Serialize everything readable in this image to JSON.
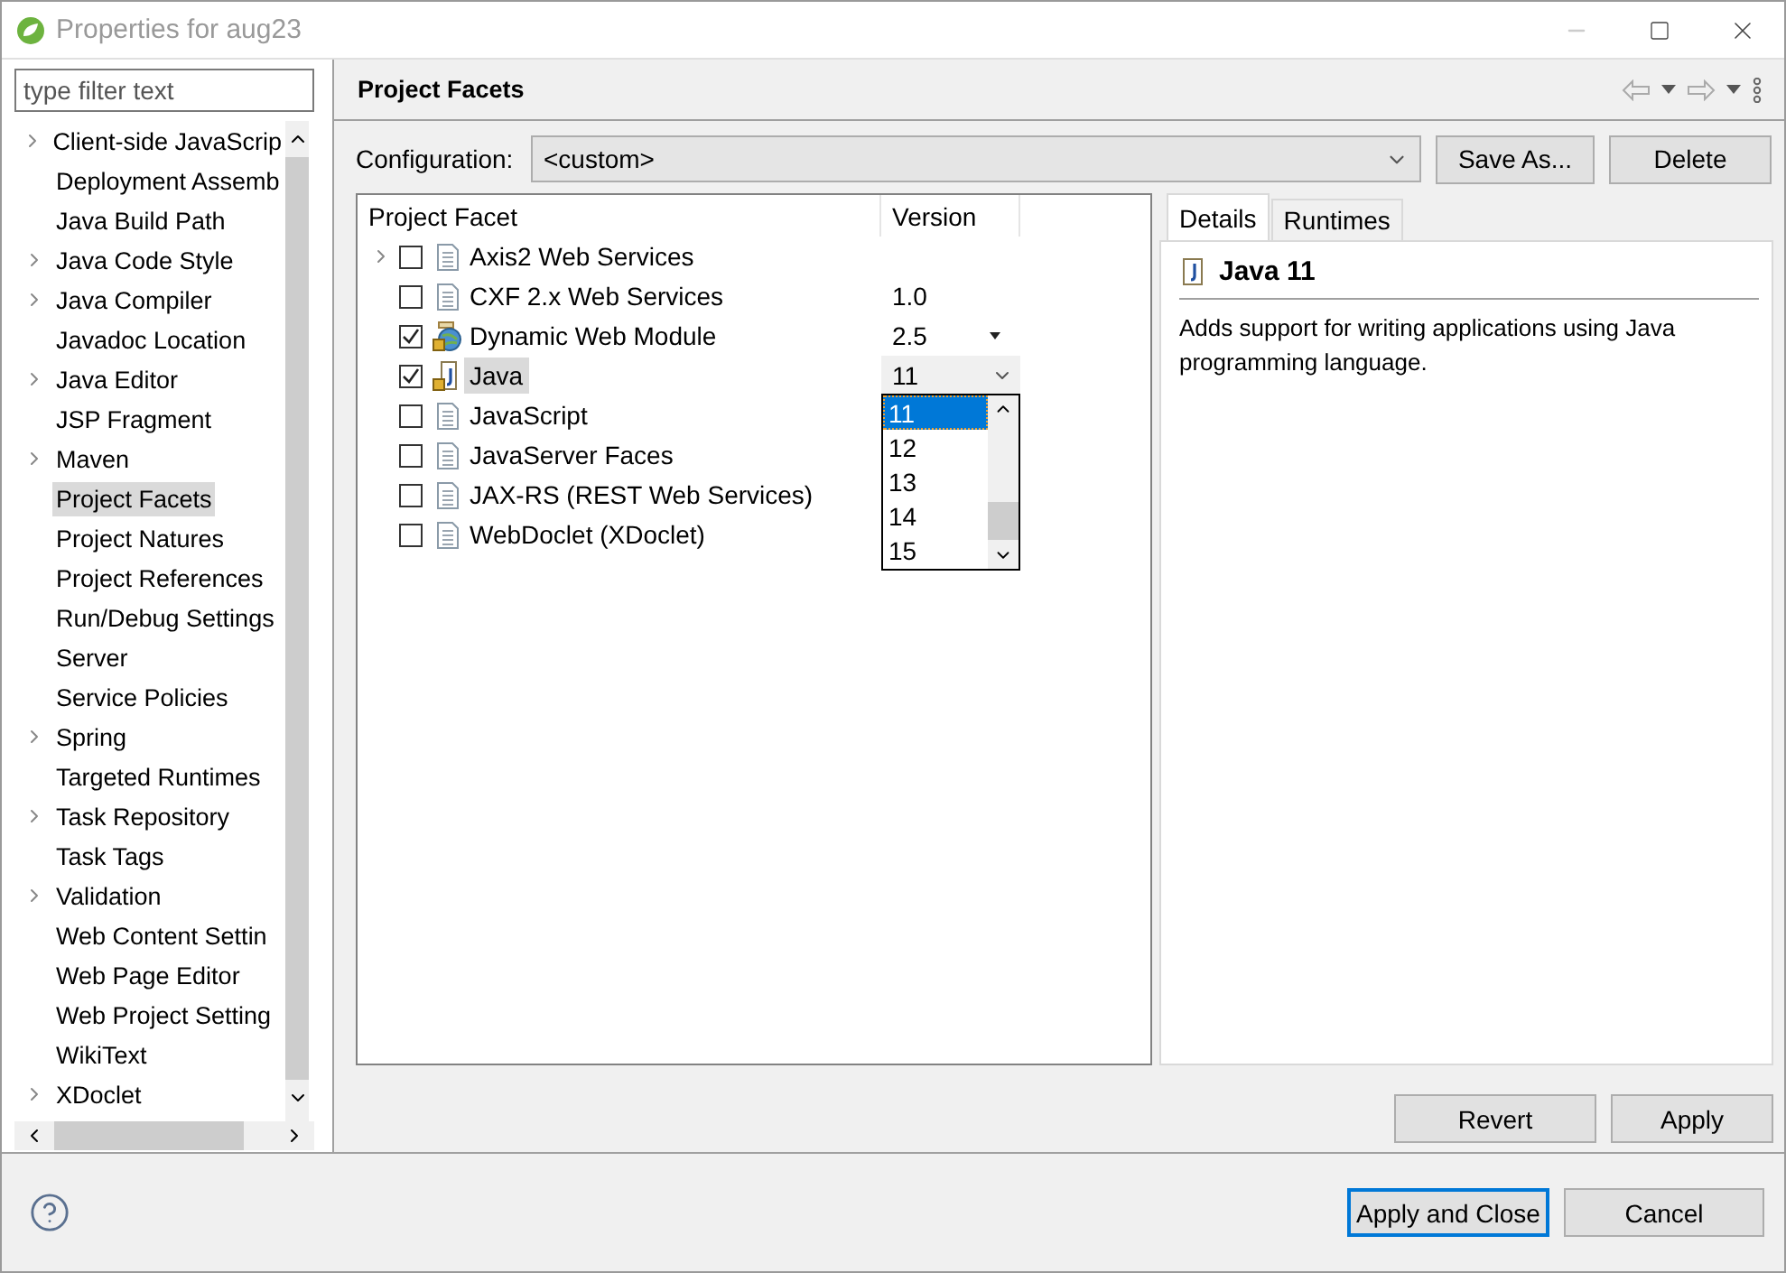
{
  "window": {
    "title": "Properties for aug23"
  },
  "sidebar": {
    "filter": {
      "placeholder": "type filter text"
    },
    "items": [
      {
        "label": "Client-side JavaScrip",
        "expandable": true,
        "selected": false
      },
      {
        "label": "Deployment Assemb",
        "expandable": false,
        "selected": false
      },
      {
        "label": "Java Build Path",
        "expandable": false,
        "selected": false
      },
      {
        "label": "Java Code Style",
        "expandable": true,
        "selected": false
      },
      {
        "label": "Java Compiler",
        "expandable": true,
        "selected": false
      },
      {
        "label": "Javadoc Location",
        "expandable": false,
        "selected": false
      },
      {
        "label": "Java Editor",
        "expandable": true,
        "selected": false
      },
      {
        "label": "JSP Fragment",
        "expandable": false,
        "selected": false
      },
      {
        "label": "Maven",
        "expandable": true,
        "selected": false
      },
      {
        "label": "Project Facets",
        "expandable": false,
        "selected": true
      },
      {
        "label": "Project Natures",
        "expandable": false,
        "selected": false
      },
      {
        "label": "Project References",
        "expandable": false,
        "selected": false
      },
      {
        "label": "Run/Debug Settings",
        "expandable": false,
        "selected": false
      },
      {
        "label": "Server",
        "expandable": false,
        "selected": false
      },
      {
        "label": "Service Policies",
        "expandable": false,
        "selected": false
      },
      {
        "label": "Spring",
        "expandable": true,
        "selected": false
      },
      {
        "label": "Targeted Runtimes",
        "expandable": false,
        "selected": false
      },
      {
        "label": "Task Repository",
        "expandable": true,
        "selected": false
      },
      {
        "label": "Task Tags",
        "expandable": false,
        "selected": false
      },
      {
        "label": "Validation",
        "expandable": true,
        "selected": false
      },
      {
        "label": "Web Content Settin",
        "expandable": false,
        "selected": false
      },
      {
        "label": "Web Page Editor",
        "expandable": false,
        "selected": false
      },
      {
        "label": "Web Project Setting",
        "expandable": false,
        "selected": false
      },
      {
        "label": "WikiText",
        "expandable": false,
        "selected": false
      },
      {
        "label": "XDoclet",
        "expandable": true,
        "selected": false
      }
    ]
  },
  "page": {
    "title": "Project Facets"
  },
  "configuration": {
    "label": "Configuration:",
    "value": "<custom>",
    "buttons": [
      "Save As...",
      "Delete"
    ]
  },
  "facets": {
    "columns": [
      "Project Facet",
      "Version"
    ],
    "rows": [
      {
        "name": "Axis2 Web Services",
        "kind": "document",
        "expandable": true,
        "checked": false,
        "selected": false
      },
      {
        "name": "CXF 2.x Web Services",
        "kind": "document",
        "expandable": false,
        "checked": false,
        "selected": false,
        "version": {
          "kind": "text",
          "value": "1.0"
        }
      },
      {
        "name": "Dynamic Web Module",
        "kind": "module",
        "expandable": false,
        "checked": true,
        "selected": false,
        "version": {
          "kind": "menu",
          "value": "2.5"
        }
      },
      {
        "name": "Java",
        "kind": "java",
        "expandable": false,
        "checked": true,
        "selected": true,
        "version": {
          "kind": "combo",
          "value": "11"
        }
      },
      {
        "name": "JavaScript",
        "kind": "document",
        "expandable": false,
        "checked": false,
        "selected": false
      },
      {
        "name": "JavaServer Faces",
        "kind": "document",
        "expandable": false,
        "checked": false,
        "selected": false
      },
      {
        "name": "JAX-RS (REST Web Services)",
        "kind": "document",
        "expandable": false,
        "checked": false,
        "selected": false
      },
      {
        "name": "WebDoclet (XDoclet)",
        "kind": "document",
        "expandable": false,
        "checked": false,
        "selected": false
      }
    ],
    "dropdown": {
      "options": [
        {
          "label": "11",
          "selected": true
        },
        {
          "label": "12",
          "selected": false
        },
        {
          "label": "13",
          "selected": false
        },
        {
          "label": "14",
          "selected": false
        },
        {
          "label": "15",
          "selected": false
        }
      ]
    }
  },
  "details": {
    "tabs": [
      {
        "label": "Details",
        "selected": true
      },
      {
        "label": "Runtimes",
        "selected": false
      }
    ],
    "title": "Java 11",
    "description": "Adds support for writing applications using Java programming language."
  },
  "page_buttons": [
    "Revert",
    "Apply"
  ],
  "footer": {
    "buttons": [
      {
        "label": "Apply and Close",
        "default": true
      },
      {
        "label": "Cancel",
        "default": false
      }
    ]
  }
}
